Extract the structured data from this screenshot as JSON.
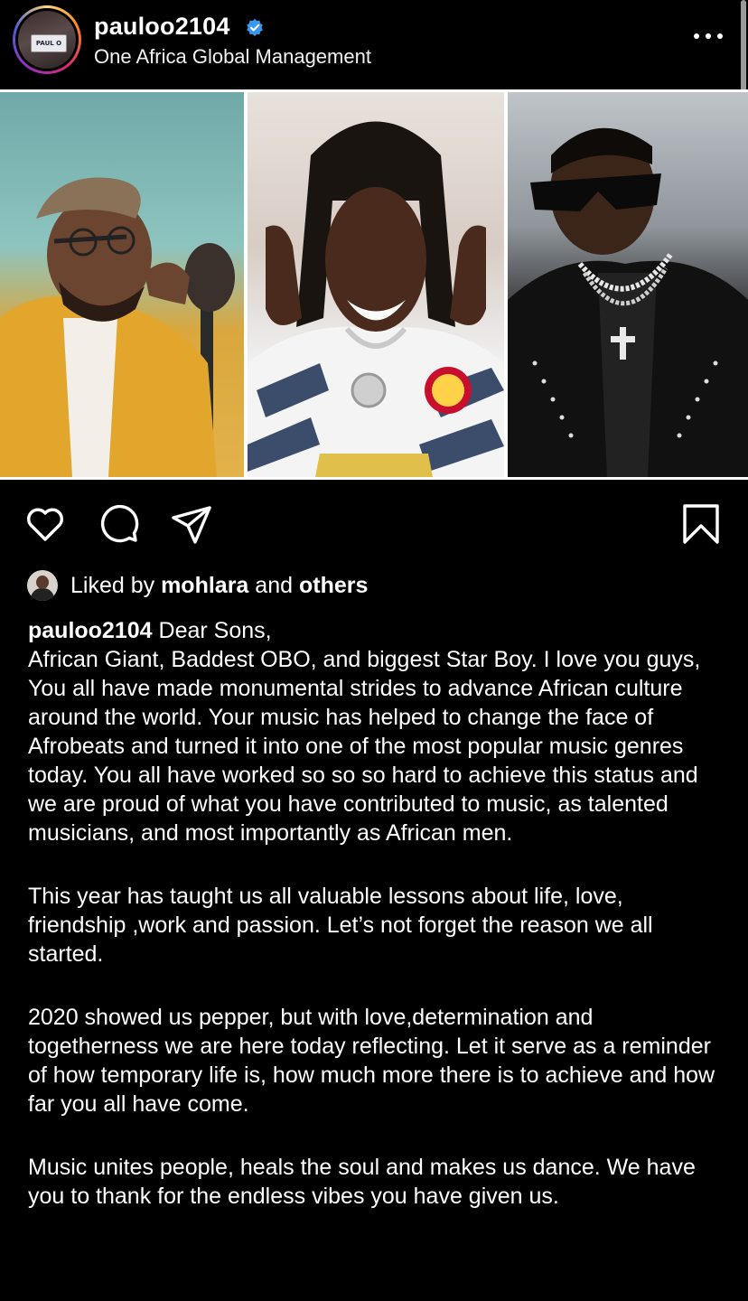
{
  "header": {
    "username": "pauloo2104",
    "subtitle": "One Africa Global Management",
    "avatar_plate_text": "PAUL O",
    "icons": {
      "verified": "verified-badge-icon",
      "more": "more-options-icon"
    }
  },
  "post": {
    "panels": [
      "panel-left",
      "panel-center",
      "panel-right"
    ]
  },
  "actions": {
    "icons": [
      "heart-icon",
      "comment-icon",
      "share-icon",
      "bookmark-icon"
    ]
  },
  "likes": {
    "prefix": "Liked by",
    "user": "mohlara",
    "joiner": "and",
    "others": "others"
  },
  "caption": {
    "username": "pauloo2104",
    "paragraph1_head": "Dear Sons,",
    "paragraph1_body": "African Giant, Baddest OBO, and biggest Star Boy. I love you guys, You all have made monumental strides to advance African culture around the world. Your music has helped to change the face of Afrobeats and turned it into one of the most popular music genres today. You all have worked so so so hard to achieve this status and we are proud of what you have contributed to music, as talented musicians, and most importantly as African men.",
    "paragraph2": "This year has taught us all valuable lessons about life, love, friendship ,work and passion. Let’s not forget the reason we all started.",
    "paragraph3": "2020 showed us pepper, but with love,determination and togetherness we are here today reflecting. Let it serve as a reminder of how temporary life is, how much more there is to achieve and how far you all have come.",
    "paragraph4": "Music unites people, heals the soul and makes us dance. We have you to thank for the endless vibes you have given us."
  },
  "colors": {
    "background": "#000000",
    "text": "#ffffff",
    "verified": "#3897f0"
  }
}
